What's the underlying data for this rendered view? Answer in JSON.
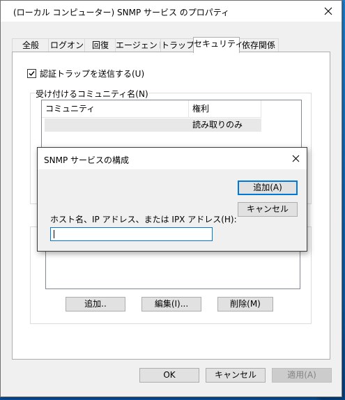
{
  "window": {
    "title": "(ローカル コンピューター) SNMP サービス のプロパティ"
  },
  "tabs": [
    {
      "label": "全般"
    },
    {
      "label": "ログオン"
    },
    {
      "label": "回復"
    },
    {
      "label": "エージェント"
    },
    {
      "label": "トラップ"
    },
    {
      "label": "セキュリティ",
      "active": true
    },
    {
      "label": "依存関係"
    }
  ],
  "security": {
    "send_auth_trap_label": "認証トラップを送信する(U)",
    "send_auth_trap_checked": true,
    "communities_group_label": "受け付けるコミュニティ名(N)",
    "communities_columns": [
      "コミュニティ",
      "権利"
    ],
    "communities_rows": [
      {
        "community": "",
        "rights": "読み取りのみ"
      }
    ],
    "add_label": "追加..",
    "edit_label": "編集(I)...",
    "remove_label": "削除(M)"
  },
  "dialog": {
    "title": "SNMP サービスの構成",
    "add_label": "追加(A)",
    "cancel_label": "キャンセル",
    "host_label": "ホスト名、IP アドレス、または IPX アドレス(H):",
    "host_value": ""
  },
  "footer": {
    "ok_label": "OK",
    "cancel_label": "キャンセル",
    "apply_label": "適用(A)"
  },
  "icons": {
    "close": "close-icon",
    "check": "checkmark-icon"
  },
  "colors": {
    "accent": "#0078d7",
    "desktop": "#0c6fc0"
  }
}
